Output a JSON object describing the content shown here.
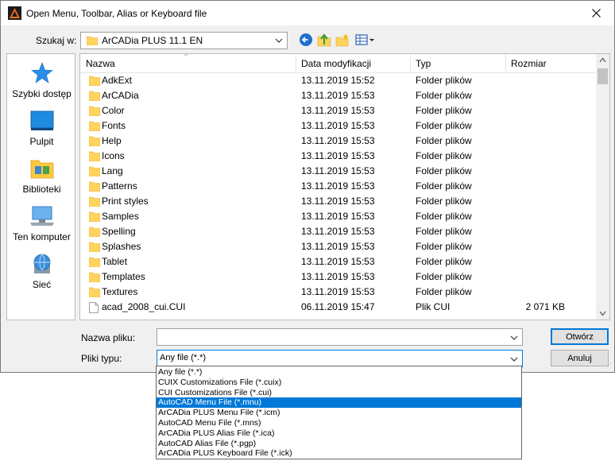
{
  "window": {
    "title": "Open Menu, Toolbar, Alias or Keyboard file"
  },
  "lookin": {
    "label": "Szukaj w:",
    "value": "ArCADia PLUS 11.1 EN"
  },
  "toolbar": {
    "icons": [
      "back-icon",
      "up-folder-icon",
      "new-folder-icon",
      "view-menu-icon"
    ]
  },
  "places": [
    {
      "label": "Szybki dostęp",
      "icon": "quick-access-star-icon"
    },
    {
      "label": "Pulpit",
      "icon": "desktop-icon"
    },
    {
      "label": "Biblioteki",
      "icon": "libraries-icon"
    },
    {
      "label": "Ten komputer",
      "icon": "computer-icon"
    },
    {
      "label": "Sieć",
      "icon": "network-icon"
    }
  ],
  "columns": {
    "name": "Nazwa",
    "date": "Data modyfikacji",
    "type": "Typ",
    "size": "Rozmiar"
  },
  "files": [
    {
      "name": "AdkExt",
      "date": "13.11.2019 15:52",
      "type": "Folder plików",
      "size": "",
      "kind": "folder"
    },
    {
      "name": "ArCADia",
      "date": "13.11.2019 15:53",
      "type": "Folder plików",
      "size": "",
      "kind": "folder"
    },
    {
      "name": "Color",
      "date": "13.11.2019 15:53",
      "type": "Folder plików",
      "size": "",
      "kind": "folder"
    },
    {
      "name": "Fonts",
      "date": "13.11.2019 15:53",
      "type": "Folder plików",
      "size": "",
      "kind": "folder"
    },
    {
      "name": "Help",
      "date": "13.11.2019 15:53",
      "type": "Folder plików",
      "size": "",
      "kind": "folder"
    },
    {
      "name": "Icons",
      "date": "13.11.2019 15:53",
      "type": "Folder plików",
      "size": "",
      "kind": "folder"
    },
    {
      "name": "Lang",
      "date": "13.11.2019 15:53",
      "type": "Folder plików",
      "size": "",
      "kind": "folder"
    },
    {
      "name": "Patterns",
      "date": "13.11.2019 15:53",
      "type": "Folder plików",
      "size": "",
      "kind": "folder"
    },
    {
      "name": "Print styles",
      "date": "13.11.2019 15:53",
      "type": "Folder plików",
      "size": "",
      "kind": "folder"
    },
    {
      "name": "Samples",
      "date": "13.11.2019 15:53",
      "type": "Folder plików",
      "size": "",
      "kind": "folder"
    },
    {
      "name": "Spelling",
      "date": "13.11.2019 15:53",
      "type": "Folder plików",
      "size": "",
      "kind": "folder"
    },
    {
      "name": "Splashes",
      "date": "13.11.2019 15:53",
      "type": "Folder plików",
      "size": "",
      "kind": "folder"
    },
    {
      "name": "Tablet",
      "date": "13.11.2019 15:53",
      "type": "Folder plików",
      "size": "",
      "kind": "folder"
    },
    {
      "name": "Templates",
      "date": "13.11.2019 15:53",
      "type": "Folder plików",
      "size": "",
      "kind": "folder"
    },
    {
      "name": "Textures",
      "date": "13.11.2019 15:53",
      "type": "Folder plików",
      "size": "",
      "kind": "folder"
    },
    {
      "name": "acad_2008_cui.CUI",
      "date": "06.11.2019 15:47",
      "type": "Plik CUI",
      "size": "2 071 KB",
      "kind": "file"
    }
  ],
  "filename": {
    "label": "Nazwa pliku:",
    "value": ""
  },
  "filetype": {
    "label": "Pliki typu:",
    "value": "Any file (*.*)",
    "options": [
      "Any file (*.*)",
      "CUIX Customizations File (*.cuix)",
      "CUI Customizations File (*.cui)",
      "AutoCAD Menu File (*.mnu)",
      "ArCADia PLUS Menu File (*.icm)",
      "AutoCAD Menu File (*.mns)",
      "ArCADia PLUS Alias File (*.ica)",
      "AutoCAD Alias File (*.pgp)",
      "ArCADia PLUS Keyboard File (*.ick)"
    ],
    "highlighted_index": 3
  },
  "buttons": {
    "open": "Otwórz",
    "cancel": "Anuluj"
  },
  "colors": {
    "accent": "#0078d7",
    "folder": "#ffd35c"
  }
}
